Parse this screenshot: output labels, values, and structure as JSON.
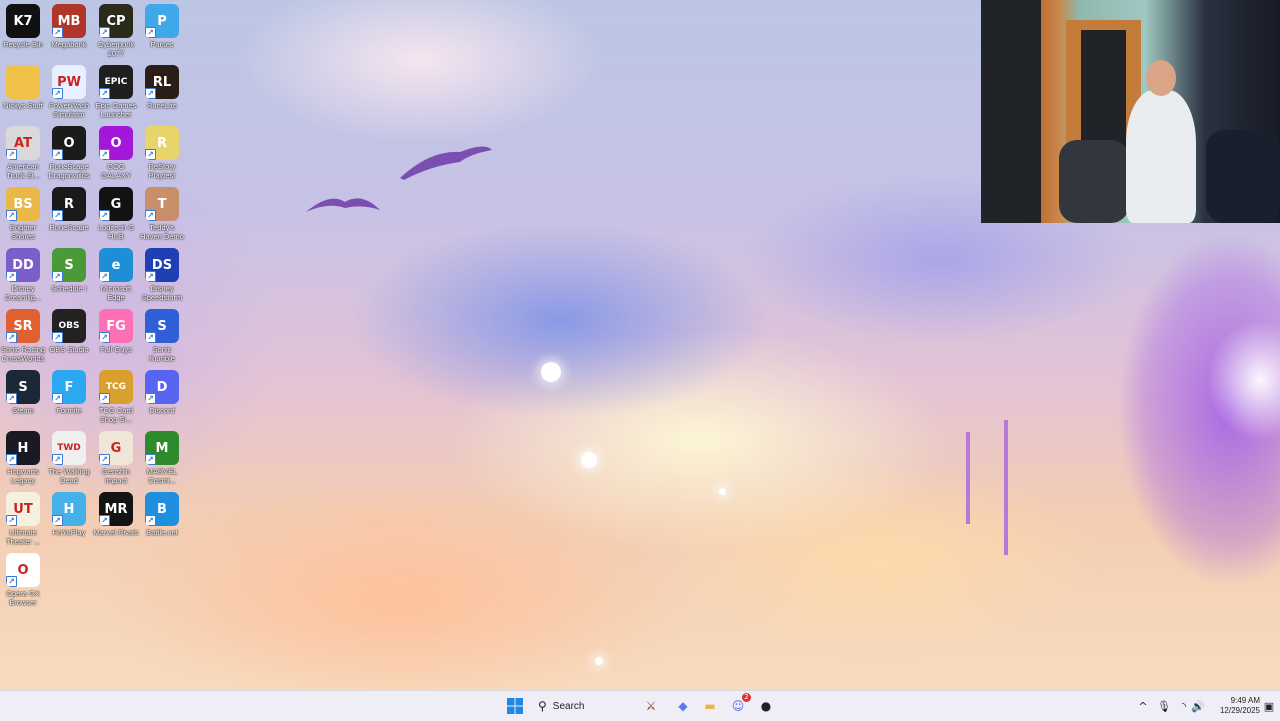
{
  "desktop": {
    "icons": [
      {
        "label": "Recycle Bin",
        "icon": "k7-recycle-bin-icon",
        "bg": "#111111",
        "glyph": "K7"
      },
      {
        "label": "Megabonk",
        "icon": "megabonk-icon",
        "bg": "#b0362a",
        "glyph": "MB"
      },
      {
        "label": "Cyberpunk 2077",
        "icon": "cyberpunk-icon",
        "bg": "#2b2b1c",
        "glyph": "CP"
      },
      {
        "label": "Parsec",
        "icon": "parsec-icon",
        "bg": "#3fa8e8",
        "glyph": "P"
      },
      {
        "label": "Nickys Stuff",
        "icon": "folder-icon",
        "bg": "#f0c24a",
        "glyph": ""
      },
      {
        "label": "PowerWash Simulator",
        "icon": "powerwash-icon",
        "bg": "#e8f0ff",
        "glyph": "PW"
      },
      {
        "label": "Epic Games Launcher",
        "icon": "epic-games-icon",
        "bg": "#1f1f1f",
        "glyph": "EPIC"
      },
      {
        "label": "RuneLite",
        "icon": "runelite-icon",
        "bg": "#2a1e16",
        "glyph": "RL"
      },
      {
        "label": "American Truck Si...",
        "icon": "american-truck-icon",
        "bg": "#d9d9d9",
        "glyph": "AT"
      },
      {
        "label": "RuneScape Dragonwilds",
        "icon": "runescape-dragonwilds-icon",
        "bg": "#1b1b1b",
        "glyph": "O"
      },
      {
        "label": "GOG GALAXY",
        "icon": "gog-galaxy-icon",
        "bg": "#a416d9",
        "glyph": "O"
      },
      {
        "label": "ReStory Playtest",
        "icon": "restory-icon",
        "bg": "#e8d56a",
        "glyph": "R"
      },
      {
        "label": "Brighter Shores",
        "icon": "brighter-shores-icon",
        "bg": "#e8b848",
        "glyph": "BS"
      },
      {
        "label": "RuneScape",
        "icon": "runescape-icon",
        "bg": "#1a1a1a",
        "glyph": "R"
      },
      {
        "label": "Logitech G HUB",
        "icon": "logitech-ghub-icon",
        "bg": "#121212",
        "glyph": "G"
      },
      {
        "label": "Teddy's Haven Demo",
        "icon": "teddys-haven-icon",
        "bg": "#c8906a",
        "glyph": "T"
      },
      {
        "label": "Disney Dreamlig...",
        "icon": "disney-dreamlight-icon",
        "bg": "#7a5ec9",
        "glyph": "DD"
      },
      {
        "label": "Schedule I",
        "icon": "schedule-one-icon",
        "bg": "#4a9a3a",
        "glyph": "S"
      },
      {
        "label": "Microsoft Edge",
        "icon": "microsoft-edge-icon",
        "bg": "#1e8fd6",
        "glyph": "e"
      },
      {
        "label": "Disney Speedstorm",
        "icon": "disney-speedstorm-icon",
        "bg": "#1f3fb5",
        "glyph": "DS"
      },
      {
        "label": "Sonic Racing CrossWorlds",
        "icon": "sonic-racing-icon",
        "bg": "#e06030",
        "glyph": "SR"
      },
      {
        "label": "OBS Studio",
        "icon": "obs-studio-icon",
        "bg": "#222222",
        "glyph": "OBS"
      },
      {
        "label": "Fall Guys",
        "icon": "fall-guys-icon",
        "bg": "#ff6fb5",
        "glyph": "FG"
      },
      {
        "label": "Sonic Rumble",
        "icon": "sonic-rumble-icon",
        "bg": "#2f5fd6",
        "glyph": "S"
      },
      {
        "label": "Steam",
        "icon": "steam-icon",
        "bg": "#1b2838",
        "glyph": "S"
      },
      {
        "label": "Fortnite",
        "icon": "fortnite-icon",
        "bg": "#2aa8f0",
        "glyph": "F"
      },
      {
        "label": "TCG Card Shop Si...",
        "icon": "tcg-card-shop-icon",
        "bg": "#d9a030",
        "glyph": "TCG"
      },
      {
        "label": "Discord",
        "icon": "discord-icon",
        "bg": "#5865f2",
        "glyph": "D"
      },
      {
        "label": "Hogwarts Legacy",
        "icon": "hogwarts-legacy-icon",
        "bg": "#1a1a24",
        "glyph": "H"
      },
      {
        "label": "The Walking Dead",
        "icon": "walking-dead-icon",
        "bg": "#efefef",
        "glyph": "TWD"
      },
      {
        "label": "Genshin Impact",
        "icon": "genshin-impact-icon",
        "bg": "#efe6d8",
        "glyph": "G"
      },
      {
        "label": "MARVEL Cosmi...",
        "icon": "marvel-cosmic-icon",
        "bg": "#2d8a2d",
        "glyph": "M"
      },
      {
        "label": "Ultimate Theater ...",
        "icon": "ultimate-theater-icon",
        "bg": "#f5f0e0",
        "glyph": "UT"
      },
      {
        "label": "HoYoPlay",
        "icon": "hoyoplay-icon",
        "bg": "#46b0e8",
        "glyph": "H"
      },
      {
        "label": "Marvel Rivals",
        "icon": "marvel-rivals-icon",
        "bg": "#141414",
        "glyph": "MR"
      },
      {
        "label": "Battle.net",
        "icon": "battle-net-icon",
        "bg": "#1f8fe0",
        "glyph": "B"
      },
      {
        "label": "Opera GX Browser",
        "icon": "opera-gx-icon",
        "bg": "#ffffff",
        "glyph": "O"
      }
    ]
  },
  "webcam": {
    "label": "webcam-overlay"
  },
  "taskbar": {
    "start_icon": "windows-start-icon",
    "search_placeholder": "Search",
    "pinned": [
      {
        "name": "game-app-icon",
        "glyph": "⚔",
        "color": "#8a3a2a"
      },
      {
        "name": "copilot-icon",
        "glyph": "◆",
        "color": "#5a7af0"
      },
      {
        "name": "file-explorer-icon",
        "glyph": "▬",
        "color": "#e8b84a"
      },
      {
        "name": "discord-taskbar-icon",
        "glyph": "☺",
        "color": "#5865f2",
        "badge": "2"
      },
      {
        "name": "game-launcher-icon",
        "glyph": "●",
        "color": "#222222"
      }
    ],
    "tray": {
      "chevron": "^",
      "mic": "🎙",
      "wifi": "◝",
      "volume": "🔊",
      "time": "9:49 AM",
      "date": "12/29/2025",
      "notification": "▣"
    }
  }
}
